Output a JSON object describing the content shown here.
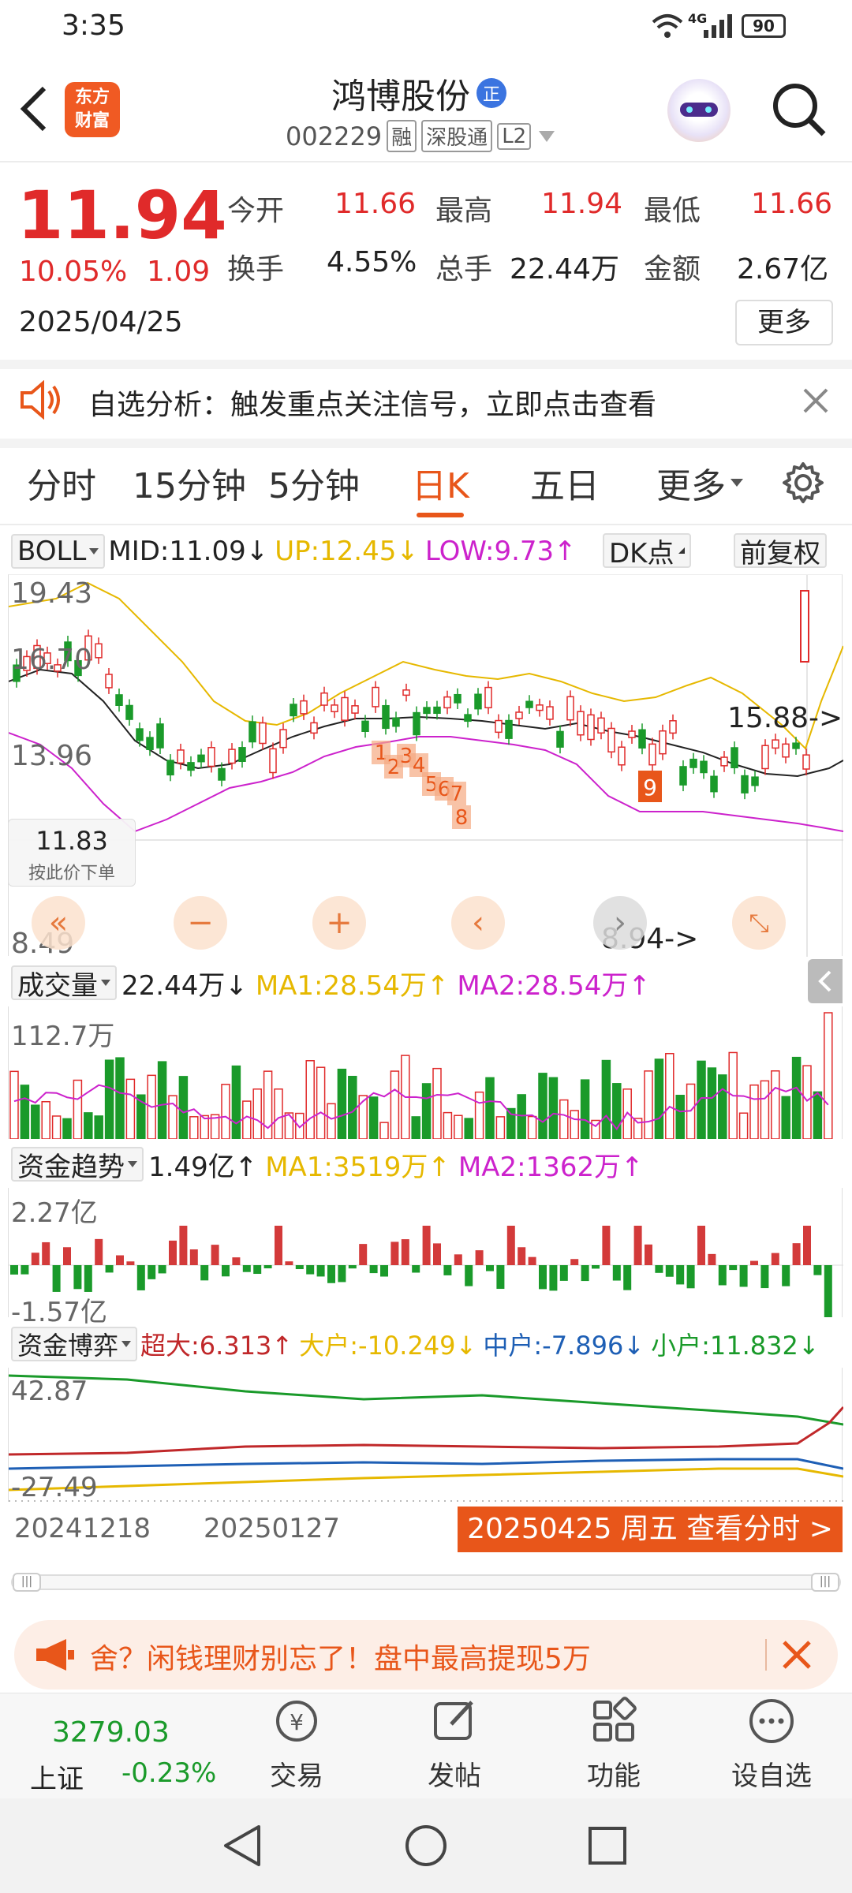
{
  "status_bar": {
    "time": "3:35",
    "network": "4G",
    "battery": "90"
  },
  "header": {
    "logo_line1": "东方",
    "logo_line2": "财富",
    "stock_name": "鸿博股份",
    "stock_badge": "正",
    "stock_code": "002229",
    "tags": [
      "融",
      "深股通",
      "L2"
    ]
  },
  "quote": {
    "price": "11.94",
    "change_pct": "10.05%",
    "change_amt": "1.09",
    "date": "2025/04/25",
    "fields": [
      {
        "label": "今开",
        "value": "11.66",
        "color": "#e02a2a"
      },
      {
        "label": "最高",
        "value": "11.94",
        "color": "#e02a2a"
      },
      {
        "label": "最低",
        "value": "11.66",
        "color": "#e02a2a"
      },
      {
        "label": "换手",
        "value": "4.55%",
        "color": "#222222"
      },
      {
        "label": "总手",
        "value": "22.44万",
        "color": "#222222"
      },
      {
        "label": "金额",
        "value": "2.67亿",
        "color": "#222222"
      }
    ],
    "more_label": "更多"
  },
  "banner": {
    "text": "自选分析：触发重点关注信号，立即点击查看"
  },
  "tabs": [
    "分时",
    "15分钟",
    "5分钟",
    "日K",
    "五日",
    "更多"
  ],
  "active_tab": "日K",
  "kline_header": {
    "indicator": "BOLL",
    "mid": "MID:11.09↓",
    "up": "UP:12.45↓",
    "low": "LOW:9.73↑",
    "dk_label": "DK点",
    "adjust_label": "前复权"
  },
  "kline": {
    "y_labels": [
      "19.43",
      "16.70",
      "13.96",
      "8.49"
    ],
    "high_marker": "15.88->",
    "low_marker": "8.94->",
    "price_tip_value": "11.83",
    "price_tip_label": "按此价下单",
    "signal_numbers": [
      "1",
      "2",
      "3",
      "4",
      "5",
      "6",
      "7",
      "8",
      "9"
    ]
  },
  "volume": {
    "label": "成交量",
    "value": "22.44万↓",
    "ma1": "MA1:28.54万↑",
    "ma2": "MA2:28.54万↑",
    "y_top": "112.7万"
  },
  "fund_trend": {
    "label": "资金趋势",
    "value": "1.49亿↑",
    "ma1": "MA1:3519万↑",
    "ma2": "MA2:1362万↑",
    "y_top": "2.27亿",
    "y_bottom": "-1.57亿"
  },
  "fund_game": {
    "label": "资金博弈",
    "super": "超大:6.313↑",
    "large": "大户:-10.249↓",
    "medium": "中户:-7.896↓",
    "small": "小户:11.832↓",
    "y_top": "42.87",
    "y_bottom": "-27.49"
  },
  "dates": {
    "d1": "20241218",
    "d2": "20250127",
    "selected": "20250425 周五 查看分时 >"
  },
  "ad": {
    "text": "舍？闲钱理财别忘了！盘中最高提现5万"
  },
  "bottom_nav": {
    "index_value": "3279.03",
    "index_name": "上证",
    "index_change": "-0.23%",
    "items": [
      "交易",
      "发帖",
      "功能",
      "设自选"
    ]
  },
  "colors": {
    "red": "#e02a2a",
    "green": "#1a9a2a",
    "yellow": "#e6b800",
    "magenta": "#cc22cc",
    "accent": "#e8561a"
  }
}
